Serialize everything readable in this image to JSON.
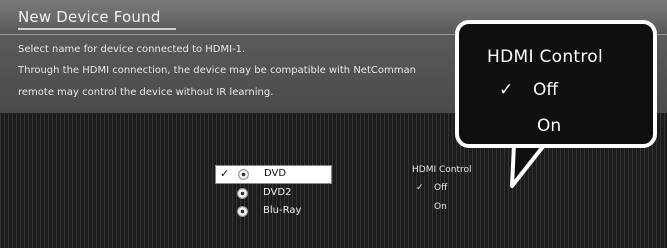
{
  "dialog": {
    "title": "New Device Found"
  },
  "description": {
    "line1": "Select name for device connected to HDMI-1.",
    "line2": "Through the HDMI connection, the device may be compatible with NetComman",
    "line3": "remote may control the device without IR learning."
  },
  "device_list": {
    "items": [
      {
        "label": "DVD",
        "selected": true,
        "check": "✓",
        "icon": "disc-icon"
      },
      {
        "label": "DVD2",
        "selected": false,
        "check": "",
        "icon": "disc-icon"
      },
      {
        "label": "Blu-Ray",
        "selected": false,
        "check": "",
        "icon": "disc-icon"
      }
    ]
  },
  "hdmi_control_small": {
    "heading": "HDMI Control",
    "options": [
      {
        "label": "Off",
        "selected": true,
        "check": "✓"
      },
      {
        "label": "On",
        "selected": false,
        "check": ""
      }
    ]
  },
  "callout": {
    "heading": "HDMI Control",
    "options": [
      {
        "label": "Off",
        "selected": true,
        "check": "✓"
      },
      {
        "label": "On",
        "selected": false,
        "check": ""
      }
    ]
  },
  "colors": {
    "background": "#2a2a2a",
    "callout_border": "#ffffff",
    "selected_bg": "#ffffff"
  }
}
